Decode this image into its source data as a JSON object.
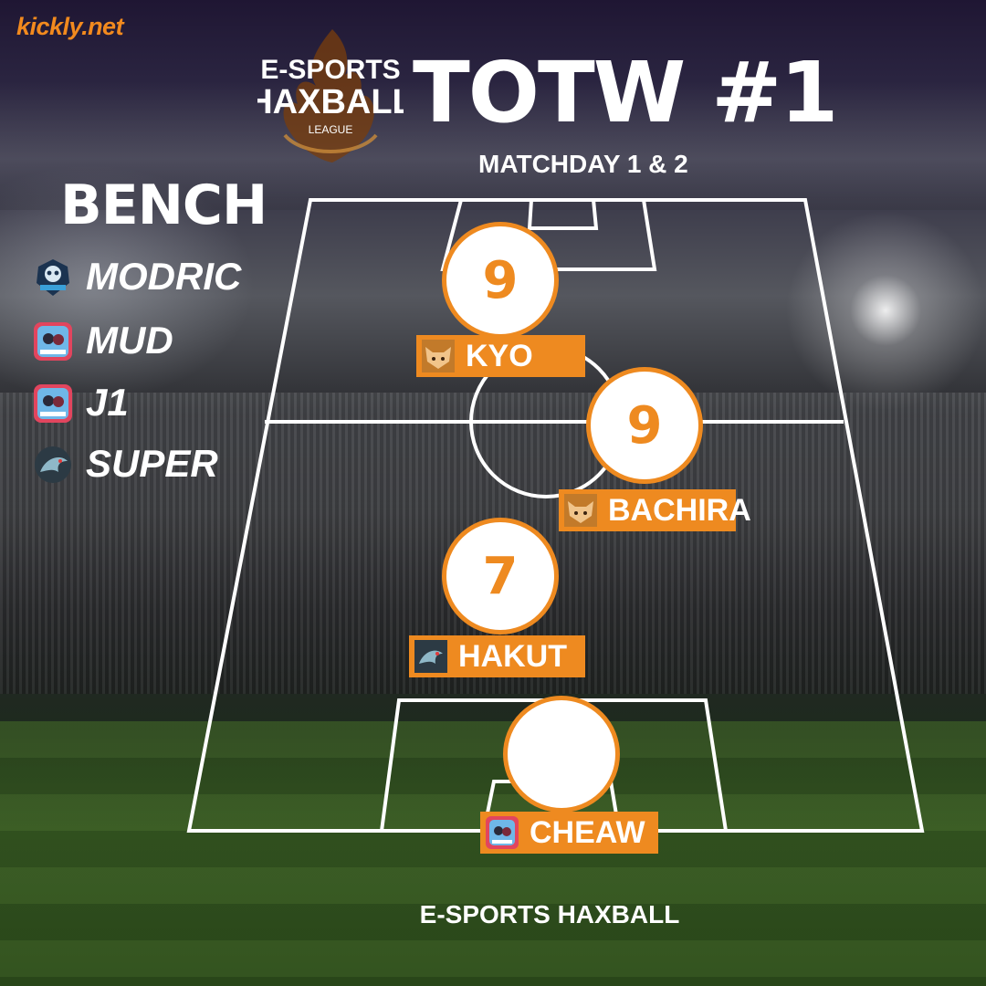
{
  "brand": "kickly.net",
  "league_logo": {
    "line1": "E-SPORTS",
    "line2": "HAXBALL",
    "line3": "LEAGUE"
  },
  "title": "TOTW #1",
  "subtitle": "MATCHDAY 1 & 2",
  "bench": {
    "title": "BENCH",
    "players": [
      {
        "name": "MODRIC",
        "icon": "skull-reaper-icon"
      },
      {
        "name": "MUD",
        "icon": "team-crest-pink-icon"
      },
      {
        "name": "J1",
        "icon": "team-crest-pink-icon"
      },
      {
        "name": "SUPER",
        "icon": "dragon-icon"
      }
    ]
  },
  "lineup": [
    {
      "position": "forward",
      "rating": "9",
      "name": "KYO",
      "icon": "fox-mask-icon"
    },
    {
      "position": "midfield",
      "rating": "9",
      "name": "BACHIRA",
      "icon": "fox-mask-icon"
    },
    {
      "position": "defense",
      "rating": "7",
      "name": "HAKUT",
      "icon": "dragon-icon"
    },
    {
      "position": "goalkeeper",
      "rating": "",
      "name": "CHEAW",
      "icon": "team-crest-pink-icon"
    }
  ],
  "footer": "E-SPORTS HAXBALL",
  "colors": {
    "accent": "#ee8a20",
    "brand": "#f28a1e",
    "pitch_lines": "#ffffff"
  }
}
